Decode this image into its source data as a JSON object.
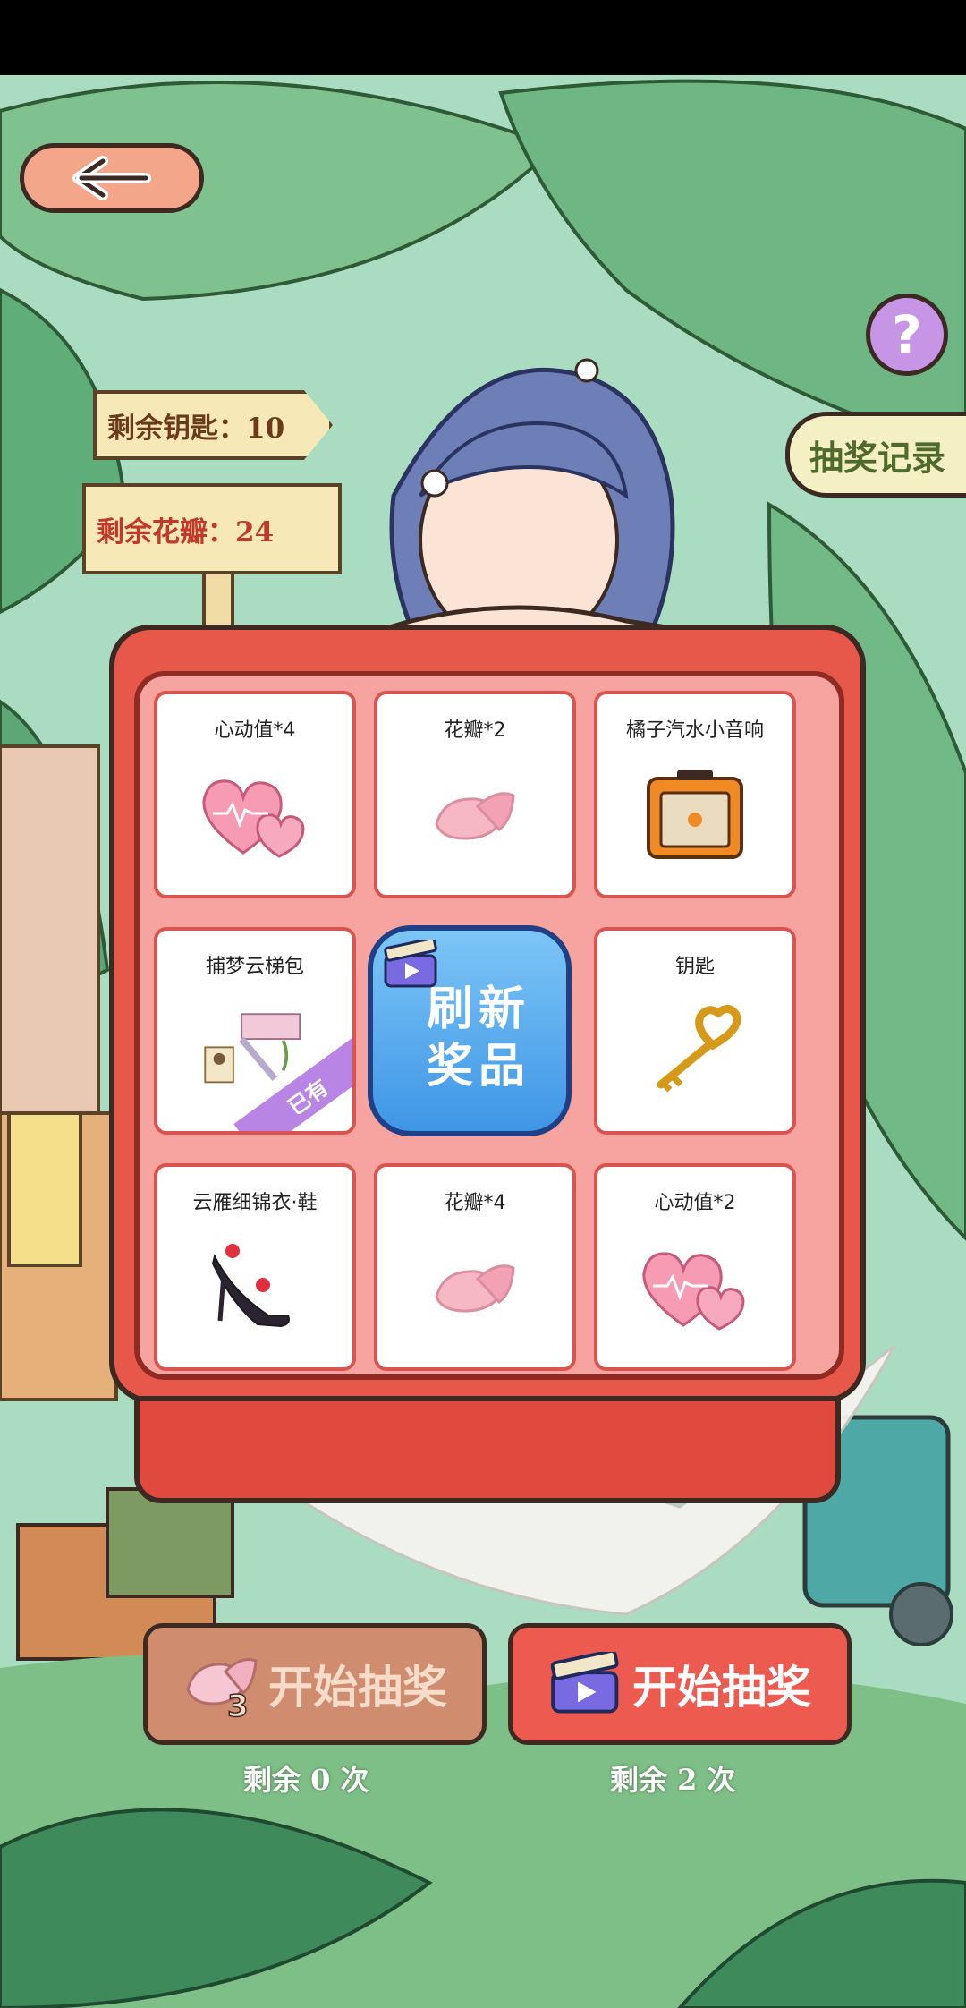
{
  "top_nav": {
    "back_icon": "arrow-left-icon",
    "help_icon": "question-icon",
    "help_label": "?",
    "record_label": "抽奖记录"
  },
  "counters": {
    "keys_label": "剩余钥匙：10",
    "petals_label": "剩余花瓣：24"
  },
  "prize_grid": {
    "cells": [
      {
        "label": "心动值*4",
        "icon": "heart-pair-icon"
      },
      {
        "label": "花瓣*2",
        "icon": "petal-icon"
      },
      {
        "label": "橘子汽水小音响",
        "icon": "amplifier-icon"
      },
      {
        "label": "捕梦云梯包",
        "icon": "cloud-ladder-room-icon",
        "badge": "已有"
      },
      {
        "label": "钥匙",
        "icon": "heart-key-icon"
      },
      {
        "label": "云雁细锦衣·鞋",
        "icon": "high-heels-icon"
      },
      {
        "label": "花瓣*4",
        "icon": "petal-icon"
      },
      {
        "label": "心动值*2",
        "icon": "heart-pair-icon"
      }
    ],
    "refresh_label": "刷新奖品",
    "refresh_icon": "video-clapper-icon"
  },
  "actions": {
    "petal_draw": {
      "label": "开始抽奖",
      "cost": "3",
      "icon": "petal-icon",
      "remaining": "剩余 0 次"
    },
    "video_draw": {
      "label": "开始抽奖",
      "icon": "video-clapper-icon",
      "remaining": "剩余 2 次"
    }
  },
  "colors": {
    "machine_red": "#e8584a",
    "refresh_blue": "#3f96e6",
    "owned_badge": "#b985e5",
    "sign_red_text": "#c0392b"
  }
}
